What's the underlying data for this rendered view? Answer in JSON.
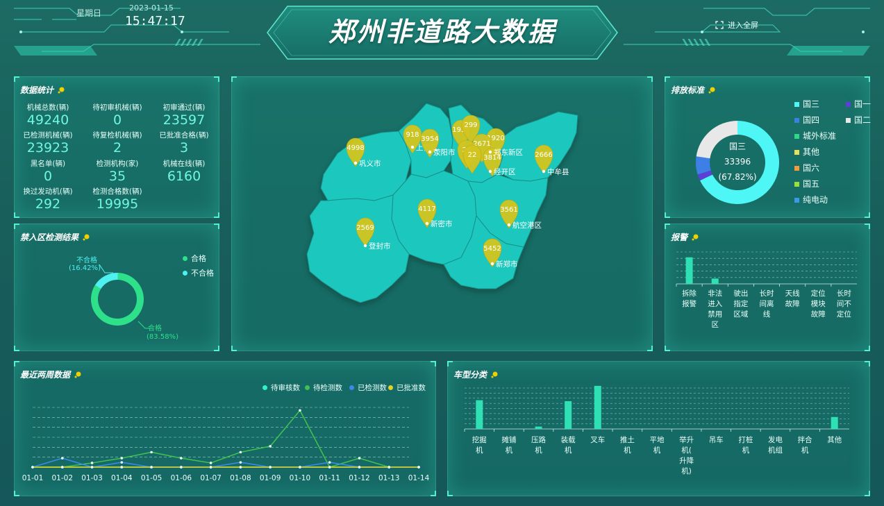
{
  "header": {
    "title": "郑州非道路大数据",
    "weekday": "星期日",
    "date": "2023-01-15",
    "time": "15:47:17",
    "fullscreen_label": "进入全屏"
  },
  "stats": {
    "title": "数据统计",
    "items": [
      {
        "label": "机械总数(辆)",
        "value": "49240"
      },
      {
        "label": "待初审机械(辆)",
        "value": "0"
      },
      {
        "label": "初审通过(辆)",
        "value": "23597"
      },
      {
        "label": "已检测机械(辆)",
        "value": "23923"
      },
      {
        "label": "待复检机械(辆)",
        "value": "2"
      },
      {
        "label": "已批准合格(辆)",
        "value": "3"
      },
      {
        "label": "黑名单(辆)",
        "value": "0"
      },
      {
        "label": "检测机构(家)",
        "value": "35"
      },
      {
        "label": "机械在线(辆)",
        "value": "6160"
      },
      {
        "label": "换过发动机(辆)",
        "value": "292"
      },
      {
        "label": "检测合格数(辆)",
        "value": "19995"
      }
    ]
  },
  "forbidden": {
    "title": "禁入区检测结果",
    "legend": [
      {
        "name": "合格",
        "color": "#2fe08a"
      },
      {
        "name": "不合格",
        "color": "#4ff0f0"
      }
    ],
    "label_pass_name": "合格",
    "label_pass_pct": "(83.58%)",
    "label_fail_name": "不合格",
    "label_fail_pct": "(16.42%)",
    "chart_data": {
      "type": "pie",
      "categories": [
        "合格",
        "不合格"
      ],
      "values": [
        83.58,
        16.42
      ]
    }
  },
  "map": {
    "markers": [
      {
        "value": "4998",
        "place": "巩义市"
      },
      {
        "value": "918",
        "place": "上街区"
      },
      {
        "value": "3954",
        "place": "荥阳市"
      },
      {
        "value": "1935",
        "place": ""
      },
      {
        "value": "299",
        "place": ""
      },
      {
        "value": "1920",
        "place": ""
      },
      {
        "value": "2671",
        "place": ""
      },
      {
        "value": "3814",
        "place": "郑东新区"
      },
      {
        "value": "26",
        "place": ""
      },
      {
        "value": "22",
        "place": ""
      },
      {
        "value": "2666",
        "place": "中牟县"
      },
      {
        "value": "",
        "place": "经开区"
      },
      {
        "value": "4117",
        "place": "新密市"
      },
      {
        "value": "3561",
        "place": "航空港区"
      },
      {
        "value": "2569",
        "place": "登封市"
      },
      {
        "value": "5452",
        "place": "新郑市"
      }
    ]
  },
  "emission": {
    "title": "排放标准",
    "center_name": "国三",
    "center_value": "33396",
    "center_pct": "(67.82%)",
    "legend": [
      {
        "name": "国三",
        "color": "#4ff6f6"
      },
      {
        "name": "国一",
        "color": "#5b3fd6"
      },
      {
        "name": "国四",
        "color": "#3e7fe6"
      },
      {
        "name": "国二",
        "color": "#e8e8e8"
      },
      {
        "name": "城外标准",
        "color": "#2fd886"
      },
      {
        "name": "其他",
        "color": "#e6e05a"
      },
      {
        "name": "国六",
        "color": "#f39a3a"
      },
      {
        "name": "国五",
        "color": "#9ddf3a"
      },
      {
        "name": "纯电动",
        "color": "#3a9ae6"
      }
    ],
    "chart_data": {
      "type": "pie",
      "categories": [
        "国三",
        "国一",
        "国四",
        "国二"
      ],
      "values": [
        67.82,
        2.5,
        7.0,
        22.68
      ]
    }
  },
  "alarm": {
    "title": "报警",
    "categories": [
      "拆除\n报警",
      "非法\n进入\n禁用\n区",
      "驶出\n指定\n区域",
      "长时\n间离\n线",
      "天线\n故障",
      "定位\n模块\n故障",
      "长时\n间不\n定位"
    ],
    "chart_data": {
      "type": "bar",
      "categories": [
        "拆除报警",
        "非法进入禁用区",
        "驶出指定区域",
        "长时间离线",
        "天线故障",
        "定位模块故障",
        "长时间不定位"
      ],
      "values": [
        20,
        4,
        0,
        0,
        0,
        0,
        0
      ],
      "ylim": [
        0,
        24
      ]
    }
  },
  "trend": {
    "title": "最近两周数据",
    "chart_data": {
      "type": "line",
      "x": [
        "01-01",
        "01-02",
        "01-03",
        "01-04",
        "01-05",
        "01-06",
        "01-07",
        "01-08",
        "01-09",
        "01-10",
        "01-11",
        "01-12",
        "01-13",
        "01-14"
      ],
      "ylim": [
        0,
        100
      ],
      "series": [
        {
          "name": "待审核数",
          "color": "#2ff2c8",
          "values": [
            0,
            0,
            0,
            0,
            0,
            0,
            0,
            0,
            0,
            0,
            0,
            0,
            0,
            0
          ]
        },
        {
          "name": "待检测数",
          "color": "#3fc050",
          "values": [
            0,
            0,
            7,
            15,
            25,
            15,
            7,
            25,
            35,
            95,
            0,
            15,
            0,
            0
          ]
        },
        {
          "name": "已检测数",
          "color": "#3a8ae6",
          "values": [
            0,
            15,
            0,
            8,
            0,
            0,
            0,
            8,
            0,
            0,
            8,
            0,
            0,
            0
          ]
        },
        {
          "name": "已批准数",
          "color": "#e6d020",
          "values": [
            0,
            0,
            0,
            0,
            0,
            0,
            0,
            0,
            0,
            0,
            0,
            0,
            0,
            0
          ]
        }
      ]
    }
  },
  "vehicle": {
    "title": "车型分类",
    "categories": [
      "挖掘\n机",
      "摊铺\n机",
      "压路\n机",
      "装载\n机",
      "叉车",
      "推土\n机",
      "平地\n机",
      "举升\n机(\n升降\n机)",
      "吊车",
      "打桩\n机",
      "发电\n机组",
      "拌合\n机",
      "其他"
    ],
    "chart_data": {
      "type": "bar",
      "categories": [
        "挖掘机",
        "摊铺机",
        "压路机",
        "装载机",
        "叉车",
        "推土机",
        "平地机",
        "举升机(升降机)",
        "吊车",
        "打桩机",
        "发电机组",
        "拌合机",
        "其他"
      ],
      "values": [
        60,
        0,
        5,
        58,
        90,
        0,
        0,
        0,
        0,
        0,
        0,
        0,
        25
      ],
      "ylim": [
        0,
        100
      ]
    }
  }
}
